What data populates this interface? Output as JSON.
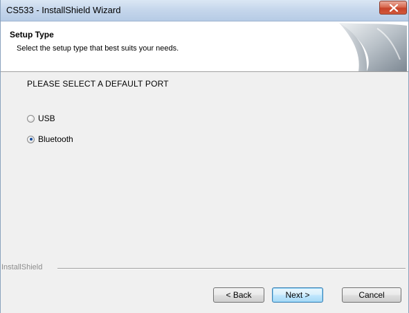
{
  "window": {
    "title": "CS533 - InstallShield Wizard"
  },
  "header": {
    "title": "Setup Type",
    "subtitle": "Select the setup type that best suits your needs."
  },
  "main": {
    "prompt": "PLEASE SELECT A DEFAULT PORT",
    "options": [
      {
        "label": "USB",
        "selected": false
      },
      {
        "label": "Bluetooth",
        "selected": true
      }
    ]
  },
  "footer": {
    "brand": "InstallShield",
    "back_label": "< Back",
    "next_label": "Next >",
    "cancel_label": "Cancel"
  },
  "colors": {
    "accent": "#3c7fb1",
    "close_red": "#c7432a"
  }
}
